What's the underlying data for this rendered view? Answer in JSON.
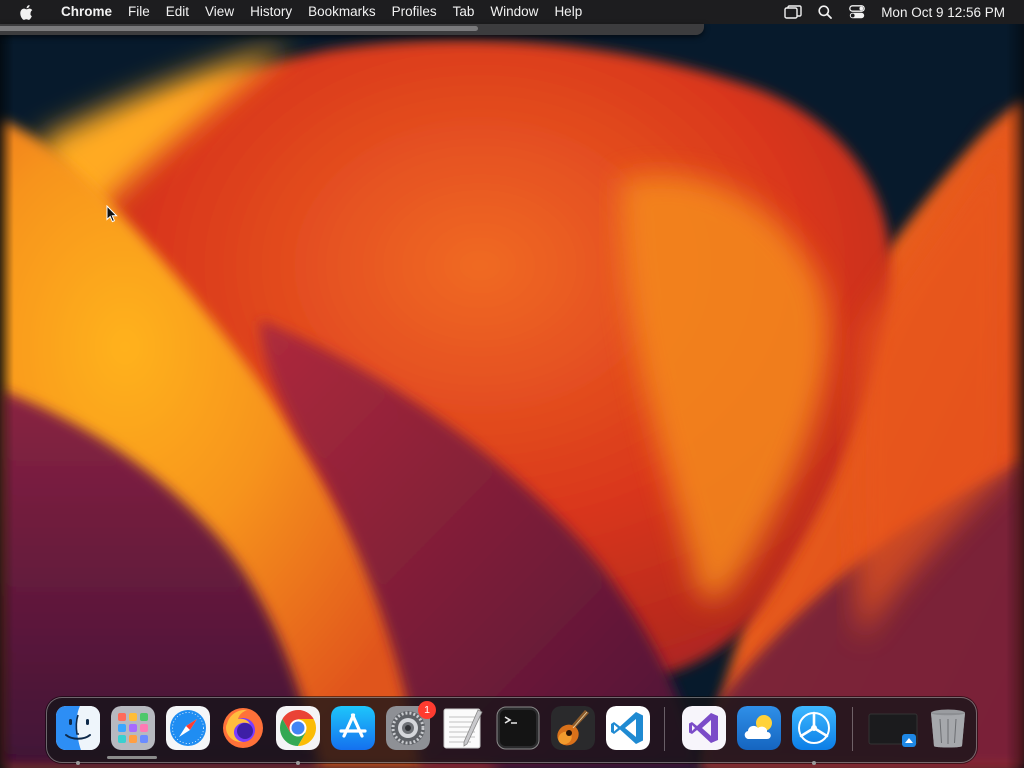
{
  "menubar": {
    "apple_icon": "apple-logo-icon",
    "app_name": "Chrome",
    "items": [
      "File",
      "Edit",
      "View",
      "History",
      "Bookmarks",
      "Profiles",
      "Tab",
      "Window",
      "Help"
    ],
    "status_icons": [
      "screen-mirroring-icon",
      "spotlight-search-icon",
      "control-center-icon"
    ],
    "clock": "Mon Oct 9  12:56 PM"
  },
  "desktop": {
    "wallpaper": "macOS Ventura orange wallpaper",
    "colors": {
      "background": "#071a2c",
      "orange": "#f7941d",
      "red": "#d9361c",
      "purple": "#5a1a44"
    }
  },
  "dock": {
    "items": [
      {
        "name": "Finder",
        "icon": "finder-icon",
        "running": true
      },
      {
        "name": "Launchpad",
        "icon": "launchpad-icon",
        "running": false
      },
      {
        "name": "Safari",
        "icon": "safari-icon",
        "running": false
      },
      {
        "name": "Firefox",
        "icon": "firefox-icon",
        "running": false
      },
      {
        "name": "Google Chrome",
        "icon": "chrome-icon",
        "running": true
      },
      {
        "name": "App Store",
        "icon": "app-store-icon",
        "running": false
      },
      {
        "name": "System Settings",
        "icon": "system-settings-icon",
        "running": false,
        "badge": "1"
      },
      {
        "name": "TextEdit",
        "icon": "textedit-icon",
        "running": false
      },
      {
        "name": "Terminal",
        "icon": "terminal-icon",
        "running": false
      },
      {
        "name": "GarageBand",
        "icon": "garageband-icon",
        "running": false
      },
      {
        "name": "Visual Studio Code",
        "icon": "vscode-icon",
        "running": false
      },
      {
        "name": "Visual Studio",
        "icon": "visual-studio-icon",
        "running": false
      },
      {
        "name": "Weather",
        "icon": "weather-icon",
        "running": false
      },
      {
        "name": "Xcode Instruments",
        "icon": "instruments-icon",
        "running": true
      },
      {
        "name": "Minimized Window",
        "icon": "minimized-window-icon",
        "running": false
      },
      {
        "name": "Trash",
        "icon": "trash-icon",
        "running": false
      }
    ]
  }
}
